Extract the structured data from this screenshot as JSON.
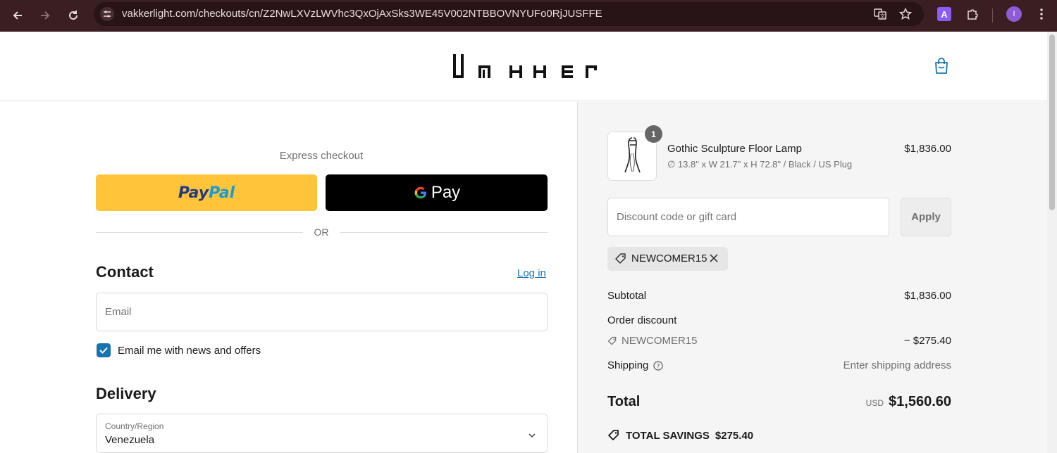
{
  "browser": {
    "url": "vakkerlight.com/checkouts/cn/Z2NwLXVzLWVhc3QxOjAxSks3WE45V002NTBBOVNYUFo0RjJUSFFE",
    "extension_label": "A",
    "profile_initial": "I"
  },
  "header": {
    "logo_alt": "Vakker"
  },
  "express": {
    "title": "Express checkout",
    "paypal_part1": "Pay",
    "paypal_part2": "Pal",
    "gpay_label": "Pay",
    "or_label": "OR"
  },
  "contact": {
    "title": "Contact",
    "login_label": "Log in",
    "email_placeholder": "Email",
    "newsletter_label": "Email me with news and offers",
    "newsletter_checked": true
  },
  "delivery": {
    "title": "Delivery",
    "country_label": "Country/Region",
    "country_value": "Venezuela"
  },
  "summary": {
    "item": {
      "quantity": "1",
      "name": "Gothic Sculpture Floor Lamp",
      "variant": "∅ 13.8\" x W 21.7\" x H 72.8\" / Black / US Plug",
      "price": "$1,836.00"
    },
    "discount_placeholder": "Discount code or gift card",
    "apply_label": "Apply",
    "applied_code": "NEWCOMER15",
    "subtotal_label": "Subtotal",
    "subtotal_value": "$1,836.00",
    "order_discount_label": "Order discount",
    "order_discount_code": "NEWCOMER15",
    "order_discount_value": "− $275.40",
    "shipping_label": "Shipping",
    "shipping_value": "Enter shipping address",
    "total_label": "Total",
    "total_currency": "USD",
    "total_value": "$1,560.60",
    "savings_label": "TOTAL SAVINGS",
    "savings_value": "$275.40"
  },
  "colors": {
    "chrome_bg": "#3a1e21",
    "link": "#1773b0",
    "paypal_yellow": "#ffc439",
    "summary_bg": "#f5f5f5"
  }
}
